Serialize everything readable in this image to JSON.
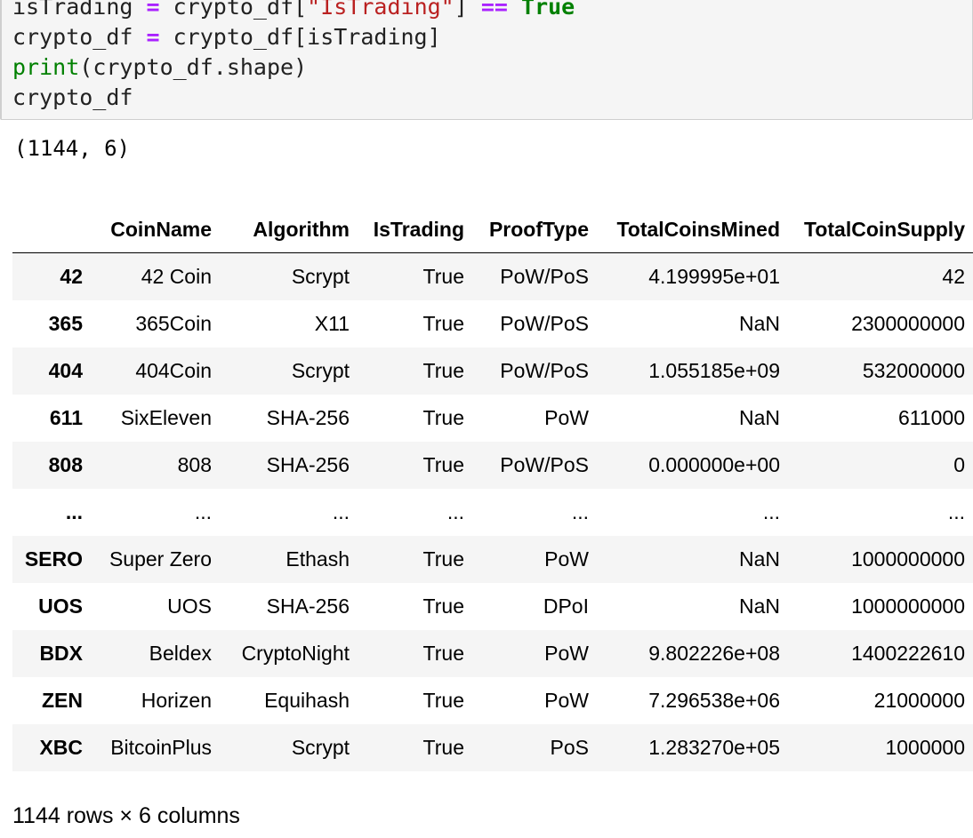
{
  "code": {
    "line1": {
      "a": "isTrading ",
      "eq": "=",
      "b": " crypto_df[",
      "str": "\"IsTrading\"",
      "c": "] ",
      "eqeq": "==",
      "d": " ",
      "kw": "True"
    },
    "line2": {
      "a": "crypto_df ",
      "eq": "=",
      "b": " crypto_df[isTrading]"
    },
    "line3": {
      "fn": "print",
      "b": "(crypto_df.shape)"
    },
    "line4": {
      "a": "crypto_df"
    }
  },
  "stdout": "(1144, 6)",
  "table": {
    "columns": [
      "",
      "CoinName",
      "Algorithm",
      "IsTrading",
      "ProofType",
      "TotalCoinsMined",
      "TotalCoinSupply"
    ],
    "rows": [
      [
        "42",
        "42 Coin",
        "Scrypt",
        "True",
        "PoW/PoS",
        "4.199995e+01",
        "42"
      ],
      [
        "365",
        "365Coin",
        "X11",
        "True",
        "PoW/PoS",
        "NaN",
        "2300000000"
      ],
      [
        "404",
        "404Coin",
        "Scrypt",
        "True",
        "PoW/PoS",
        "1.055185e+09",
        "532000000"
      ],
      [
        "611",
        "SixEleven",
        "SHA-256",
        "True",
        "PoW",
        "NaN",
        "611000"
      ],
      [
        "808",
        "808",
        "SHA-256",
        "True",
        "PoW/PoS",
        "0.000000e+00",
        "0"
      ],
      [
        "...",
        "...",
        "...",
        "...",
        "...",
        "...",
        "..."
      ],
      [
        "SERO",
        "Super Zero",
        "Ethash",
        "True",
        "PoW",
        "NaN",
        "1000000000"
      ],
      [
        "UOS",
        "UOS",
        "SHA-256",
        "True",
        "DPoI",
        "NaN",
        "1000000000"
      ],
      [
        "BDX",
        "Beldex",
        "CryptoNight",
        "True",
        "PoW",
        "9.802226e+08",
        "1400222610"
      ],
      [
        "ZEN",
        "Horizen",
        "Equihash",
        "True",
        "PoW",
        "7.296538e+06",
        "21000000"
      ],
      [
        "XBC",
        "BitcoinPlus",
        "Scrypt",
        "True",
        "PoS",
        "1.283270e+05",
        "1000000"
      ]
    ]
  },
  "shape_note": "1144 rows × 6 columns"
}
